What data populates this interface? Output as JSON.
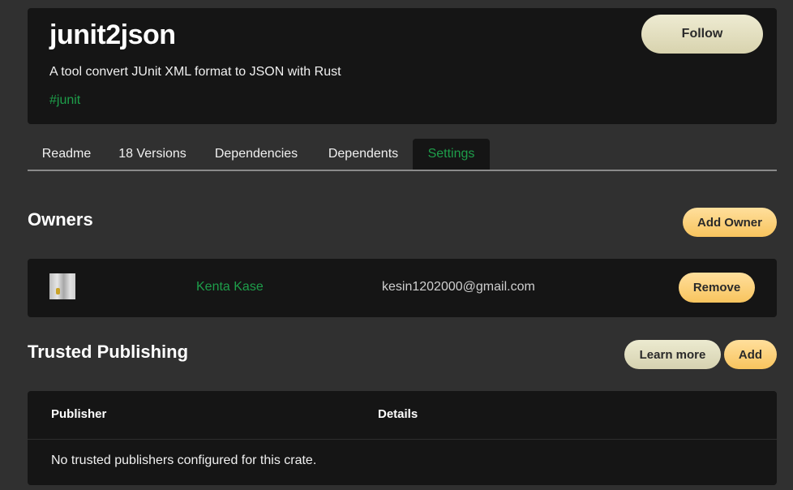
{
  "crate": {
    "name": "junit2json",
    "description": "A tool convert JUnit XML format to JSON with Rust",
    "keyword": "#junit",
    "follow_label": "Follow"
  },
  "tabs": [
    {
      "label": "Readme",
      "active": false
    },
    {
      "label": "18 Versions",
      "active": false
    },
    {
      "label": "Dependencies",
      "active": false
    },
    {
      "label": "Dependents",
      "active": false
    },
    {
      "label": "Settings",
      "active": true
    }
  ],
  "owners": {
    "title": "Owners",
    "add_label": "Add Owner",
    "items": [
      {
        "name": "Kenta Kase",
        "email": "kesin1202000@gmail.com",
        "remove_label": "Remove"
      }
    ]
  },
  "trusted_publishing": {
    "title": "Trusted Publishing",
    "learn_more_label": "Learn more",
    "add_label": "Add",
    "columns": [
      "Publisher",
      "Details"
    ],
    "empty_message": "No trusted publishers configured for this crate."
  },
  "colors": {
    "background": "#303030",
    "panel": "#151515",
    "accent_green": "#1e9e4a",
    "button_yellow": "#f8c45e",
    "button_cream": "#d8d3ae"
  }
}
